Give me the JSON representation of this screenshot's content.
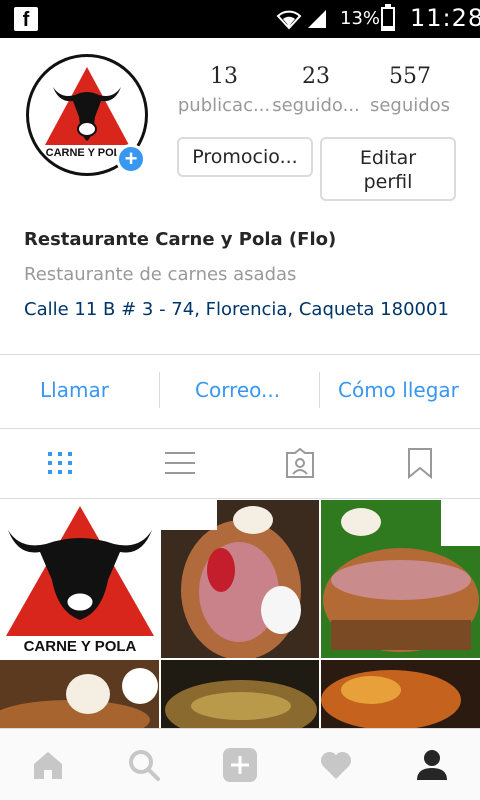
{
  "status_bar": {
    "battery_percent": "13%",
    "time": "11:28",
    "battery_level": 0.13
  },
  "profile": {
    "avatar_text": "CARNE Y POLA",
    "stats": {
      "posts": {
        "value": "13",
        "label": "publicac..."
      },
      "followers": {
        "value": "23",
        "label": "seguido..."
      },
      "following": {
        "value": "557",
        "label": "seguidos"
      }
    },
    "buttons": {
      "promote": "Promocio...",
      "edit_line1": "Editar",
      "edit_line2": "perfil"
    },
    "bio": {
      "name": "Restaurante Carne y Pola (Flo)",
      "category": "Restaurante de carnes asadas",
      "address": "Calle 11 B # 3 - 74, Florencia, Caqueta 180001"
    }
  },
  "contact": {
    "call": "Llamar",
    "email": "Correo...",
    "directions": "Cómo llegar"
  },
  "tabs": [
    "grid-icon",
    "list-icon",
    "tagged-icon",
    "saved-icon"
  ],
  "grid_posts": [
    {
      "alt": "logo",
      "text": "CARNE Y POLA"
    },
    {
      "alt": "food"
    },
    {
      "alt": "food"
    },
    {
      "alt": "food"
    },
    {
      "alt": "food"
    },
    {
      "alt": "food"
    }
  ],
  "bottom_nav": [
    "home-icon",
    "search-icon",
    "add-icon",
    "heart-icon",
    "profile-icon"
  ],
  "colors": {
    "accent": "#3897f0",
    "logo_red": "#d9261c",
    "address_blue": "#003569",
    "muted": "#999999"
  }
}
